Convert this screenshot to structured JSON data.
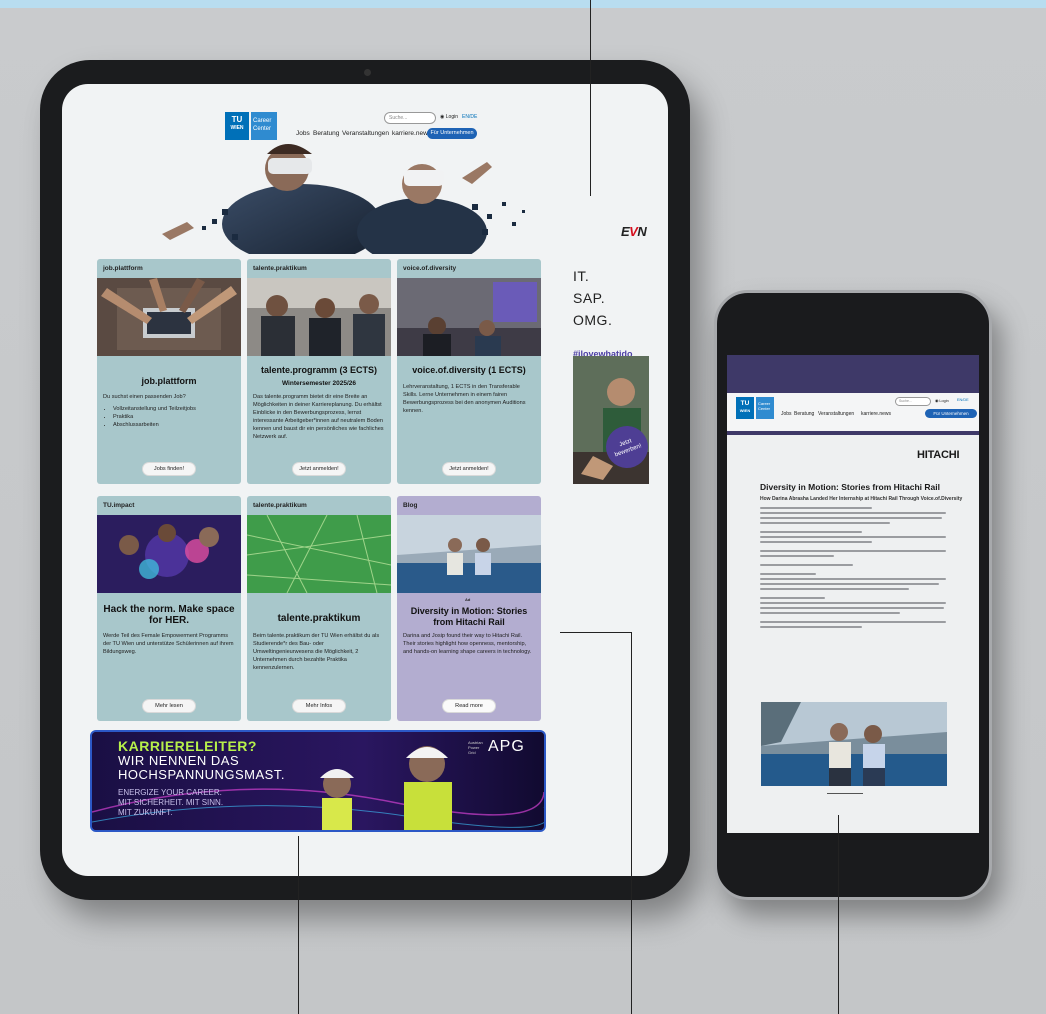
{
  "tablet": {
    "header": {
      "logo_tu": "TU",
      "logo_wien": "WIEN",
      "logo_career_line1": "Career",
      "logo_career_line2": "Center",
      "search_placeholder": "Suche...",
      "login_label": "Login",
      "lang_label": "EN/DE",
      "nav": [
        "Jobs",
        "Beratung",
        "Veranstaltungen",
        "karriere.news"
      ],
      "cta_label": "Für Unternehmen"
    },
    "sponsor_logo": {
      "pre": "E",
      "accent": "V",
      "post": "N"
    },
    "cards": [
      {
        "tag": "job.plattform",
        "title": "job.plattform",
        "text": "Du suchst einen passenden Job?",
        "bullets": [
          "Vollzeitanstellung und Teilzeitjobs",
          "Praktika",
          "Abschlussarbeiten"
        ],
        "button": "Jobs finden!"
      },
      {
        "tag": "talente.praktikum",
        "title": "talente.programm (3 ECTS)",
        "subtitle": "Wintersemester 2025/26",
        "text": "Das talente.programm bietet dir eine Breite an Möglichkeiten in deiner Karriereplanung. Du erhältst Einblicke in den Bewerbungsprozess, lernst interessante Arbeitgeber*innen auf neutralem Boden kennen und baust dir ein persönliches wie fachliches Netzwerk auf.",
        "button": "Jetzt anmelden!"
      },
      {
        "tag": "voice.of.diversity",
        "title": "voice.of.diversity (1 ECTS)",
        "text": "Lehrveranstaltung, 1 ECTS in den Transferable Skills. Lerne Unternehmen in einem fairen Bewerbungsprozess bei den anonymen Auditions kennen.",
        "button": "Jetzt anmelden!"
      },
      {
        "tag": "TU.impact",
        "title": "Hack the norm. Make space for HER.",
        "text": "Werde Teil des Female Empowerment Programms der TU Wien und unterstütze Schülerinnen auf ihrem Bildungsweg.",
        "button": "Mehr lesen"
      },
      {
        "tag": "talente.praktikum",
        "title": "talente.praktikum",
        "text": "Beim talente.praktikum der TU Wien erhältst du als Studierende*r des Bau- oder Umweltingenieurwesens die Möglichkeit, 2 Unternehmen durch bezahlte Praktika kennenzulernen.",
        "button": "Mehr Infos"
      },
      {
        "tag": "Blog",
        "ad_label": "Ad",
        "title": "Diversity in Motion: Stories from Hitachi Rail",
        "text": "Darina and Josip found their way to Hitachi Rail. Their stories highlight how openness, mentorship, and hands-on learning shape careers in technology.",
        "button": "Read more"
      }
    ],
    "side_ad": {
      "lines": [
        "IT.",
        "SAP.",
        "OMG."
      ],
      "hashtag": "#ilovewhatido",
      "badge_line1": "Jetzt",
      "badge_line2": "bewerben!"
    },
    "banner": {
      "line1": "KARRIERELEITER?",
      "line2": "WIR NENNEN DAS",
      "line3": "HOCHSPANNUNGSMAST.",
      "sub1": "ENERGIZE YOUR CAREER.",
      "sub2": "MIT SICHERHEIT. MIT SINN.",
      "sub3": "MIT ZUKUNFT.",
      "brand": "APG",
      "brand_small1": "Austrian",
      "brand_small2": "Power",
      "brand_small3": "Grid"
    }
  },
  "phone": {
    "header": {
      "search_placeholder": "Suche...",
      "login_label": "Login",
      "lang_label": "EN/DE",
      "nav": [
        "Jobs",
        "Beratung",
        "Veranstaltungen",
        "karriere.news"
      ],
      "cta_label": "Für Unternehmen",
      "logo_tu": "TU",
      "logo_wien": "WIEN",
      "logo_career_line1": "Career",
      "logo_career_line2": "Center"
    },
    "sponsor": "HITACHI",
    "article_title": "Diversity in Motion: Stories from Hitachi Rail",
    "article_subtitle": "How Darina Abrasha Landed Her Internship at Hitachi Rail Through Voice.of.Diversity"
  },
  "colors": {
    "tu_blue": "#0070b8",
    "card_teal": "#a8c7cb",
    "card_lavender": "#b3add0",
    "evn_red": "#d50f1e",
    "hashtag_purple": "#4d3fa5",
    "banner_green": "#b7f04a"
  }
}
